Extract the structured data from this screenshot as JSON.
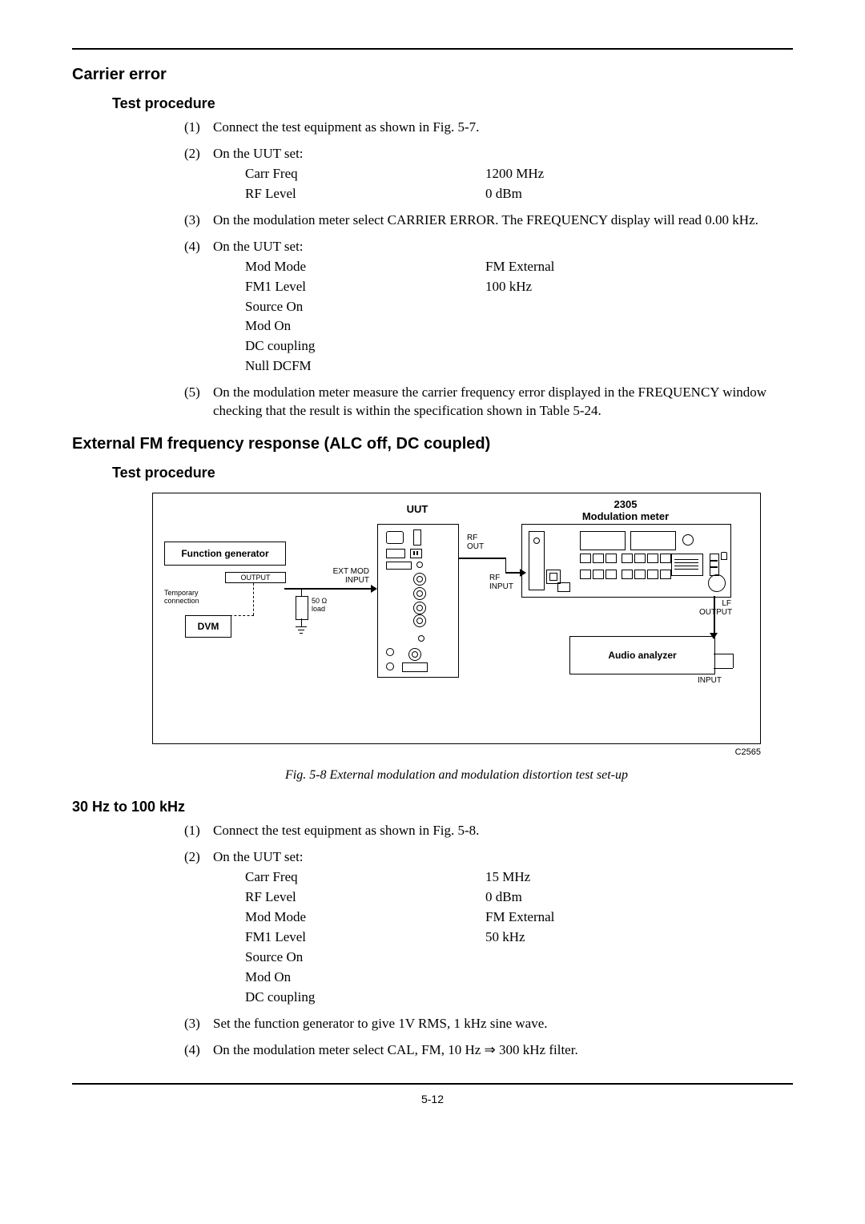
{
  "carrier_error": {
    "title": "Carrier error",
    "tp_title": "Test procedure",
    "s1": "Connect the test equipment as shown in Fig. 5-7.",
    "s2": "On the UUT set:",
    "s2_r1l": "Carr Freq",
    "s2_r1r": "1200 MHz",
    "s2_r2l": "RF Level",
    "s2_r2r": "0 dBm",
    "s3": "On the modulation meter select CARRIER ERROR.  The FREQUENCY display will read 0.00 kHz.",
    "s4": "On the UUT set:",
    "s4_r1l": "Mod Mode",
    "s4_r1r": "FM External",
    "s4_r2l": "FM1 Level",
    "s4_r2r": "100 kHz",
    "s4_r3l": "Source On",
    "s4_r4l": "Mod On",
    "s4_r5l": "DC coupling",
    "s4_r6l": "Null DCFM",
    "s5": "On the modulation meter measure the carrier frequency error displayed in the FREQUENCY window checking that the result is within the specification shown in Table 5-24."
  },
  "ext_fm": {
    "title": "External FM frequency response (ALC off, DC coupled)",
    "tp_title": "Test procedure",
    "fig_caption": "Fig. 5-8  External modulation and modulation distortion test set-up",
    "fig_ref": "C2565"
  },
  "figure": {
    "uut_label": "UUT",
    "mod_label_line1": "2305",
    "mod_label_line2": "Modulation meter",
    "func_gen": "Function generator",
    "dvm": "DVM",
    "output": "OUTPUT",
    "ext_mod_input": "EXT MOD\nINPUT",
    "temp_conn": "Temporary\nconnection",
    "load": "50 Ω\nload",
    "rf_out": "RF\nOUT",
    "rf_input": "RF\nINPUT",
    "lf_output": "LF\nOUTPUT",
    "audio": "Audio analyzer",
    "input": "INPUT"
  },
  "thirty_hz": {
    "title": "30 Hz to 100 kHz",
    "s1": "Connect the test equipment as shown in Fig. 5-8.",
    "s2": "On the UUT set:",
    "s2_r1l": "Carr Freq",
    "s2_r1r": "15 MHz",
    "s2_r2l": "RF Level",
    "s2_r2r": "0 dBm",
    "s2_r3l": "Mod Mode",
    "s2_r3r": "FM External",
    "s2_r4l": "FM1 Level",
    "s2_r4r": "50 kHz",
    "s2_r5l": "Source On",
    "s2_r6l": "Mod On",
    "s2_r7l": "DC coupling",
    "s3": "Set the function generator to give 1V RMS, 1 kHz sine wave.",
    "s4": "On the modulation meter select CAL, FM, 10 Hz ⇒ 300 kHz filter."
  },
  "footer": {
    "page_num": "5-12"
  }
}
